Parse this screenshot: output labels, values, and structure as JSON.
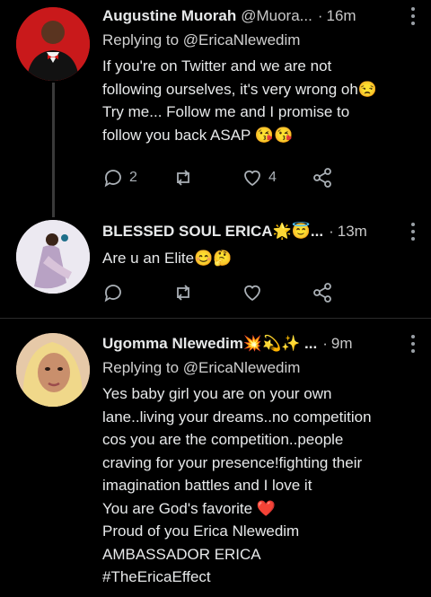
{
  "tweets": [
    {
      "name": "Augustine Muorah",
      "handle": "@Muora...",
      "time": "16m",
      "reply_prefix": "Replying to",
      "reply_to": "@EricaNlewedim",
      "text": "If you're on Twitter and we are not\nfollowing ourselves, it's very wrong oh😒\nTry me... Follow me and I promise to\nfollow you back ASAP 😘😘",
      "replies": "2",
      "retweets": "",
      "likes": "4"
    },
    {
      "name": "BLESSED SOUL ERICA🌟😇...",
      "handle": "",
      "time": "13m",
      "text": "Are u an Elite😊🤔",
      "replies": "",
      "retweets": "",
      "likes": ""
    },
    {
      "name": "Ugomma Nlewedim💥💫✨ ...",
      "handle": "",
      "time": "9m",
      "reply_prefix": "Replying to",
      "reply_to": "@EricaNlewedim",
      "text": "Yes baby girl you are on your own\nlane..living your dreams..no competition\ncos you are the competition..people\ncraving for your presence!fighting their\nimagination battles and I love it\nYou are God's favorite ❤️\nProud of you Erica Nlewedim\nAMBASSADOR ERICA\n#TheEricaEffect"
    }
  ],
  "colors": {
    "background": "#000000",
    "text": "#e7e9ea",
    "muted": "#aab0b6",
    "heart": "#e23c3c"
  },
  "icons": [
    "reply-icon",
    "retweet-icon",
    "like-icon",
    "share-icon",
    "more-icon"
  ]
}
